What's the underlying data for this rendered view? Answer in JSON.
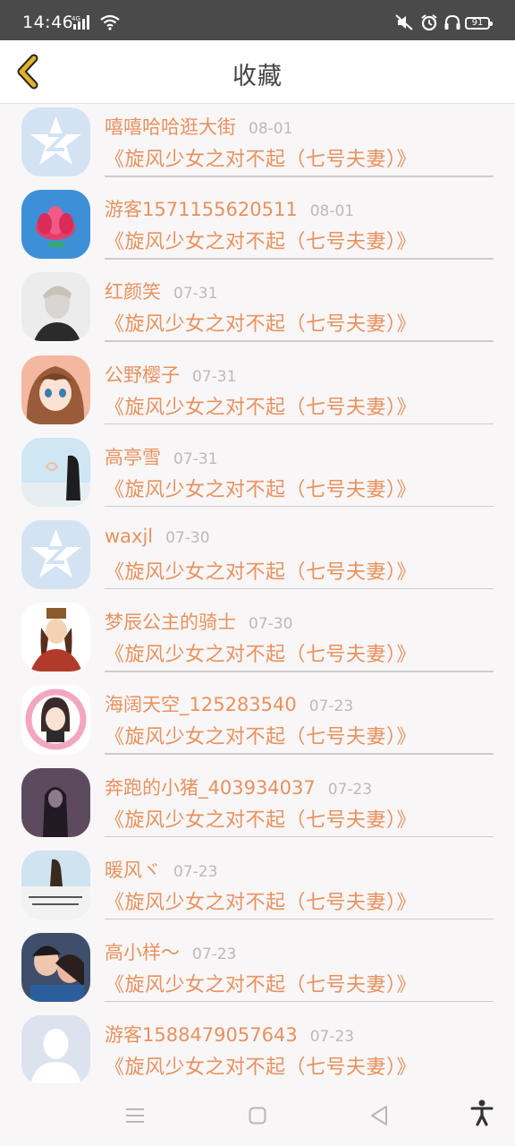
{
  "status": {
    "time": "14:46",
    "network": "4G",
    "battery": "91"
  },
  "header": {
    "title": "收藏",
    "back_icon": "chevron-left-icon"
  },
  "items": [
    {
      "name": "嘻嘻哈哈逛大街",
      "date": "08-01",
      "book": "《旋风少女之对不起（七号夫妻）》",
      "avatar": "qq-default"
    },
    {
      "name": "游客1571155620511",
      "date": "08-01",
      "book": "《旋风少女之对不起（七号夫妻）》",
      "avatar": "lotus"
    },
    {
      "name": "红颜笑",
      "date": "07-31",
      "book": "《旋风少女之对不起（七号夫妻）》",
      "avatar": "photo-man"
    },
    {
      "name": "公野樱子",
      "date": "07-31",
      "book": "《旋风少女之对不起（七号夫妻）》",
      "avatar": "anime-girl"
    },
    {
      "name": "高亭雪",
      "date": "07-31",
      "book": "《旋风少女之对不起（七号夫妻）》",
      "avatar": "photo-girl-sky"
    },
    {
      "name": "waxjl",
      "date": "07-30",
      "book": "《旋风少女之对不起（七号夫妻）》",
      "avatar": "qq-default"
    },
    {
      "name": "梦辰公主的骑士",
      "date": "07-30",
      "book": "《旋风少女之对不起（七号夫妻）》",
      "avatar": "drawing-knight"
    },
    {
      "name": "海阔天空_125283540",
      "date": "07-23",
      "book": "《旋风少女之对不起（七号夫妻）》",
      "avatar": "cartoon-girl-pink"
    },
    {
      "name": "奔跑的小猪_403934037",
      "date": "07-23",
      "book": "《旋风少女之对不起（七号夫妻）》",
      "avatar": "photo-dark"
    },
    {
      "name": "暖风ヾ",
      "date": "07-23",
      "book": "《旋风少女之对不起（七号夫妻）》",
      "avatar": "photo-text"
    },
    {
      "name": "高小样～",
      "date": "07-23",
      "book": "《旋风少女之对不起（七号夫妻）》",
      "avatar": "photo-couple"
    },
    {
      "name": "游客1588479057643",
      "date": "07-23",
      "book": "《旋风少女之对不起（七号夫妻）》",
      "avatar": "default-person"
    }
  ],
  "colors": {
    "accent": "#e8925f",
    "date": "#bdb9ba",
    "divider": "#cfcbcc",
    "back_arrow": "#e2b12a",
    "statusbar": "#4a4a4a"
  }
}
